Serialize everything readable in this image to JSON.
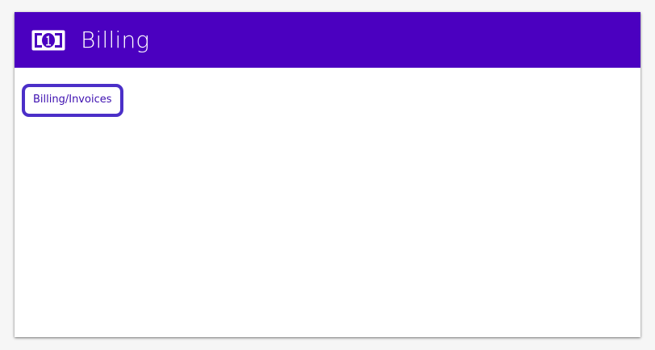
{
  "header": {
    "icon": "money-bill-icon",
    "title": "Billing",
    "background_color": "#4b00c0"
  },
  "body": {
    "link_label": "Billing/Invoices",
    "link_color": "#3d0fb0",
    "focus_border_color": "#4b2fc8"
  }
}
